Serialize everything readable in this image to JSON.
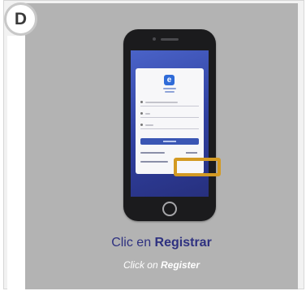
{
  "step_badge": "D",
  "caption_es": {
    "prefix": "Clic en ",
    "emphasis": "Registrar"
  },
  "caption_en": {
    "prefix": "Click on ",
    "emphasis": "Register"
  },
  "icons": {
    "app_logo": "e-app-logo",
    "phone_home": "home-button-icon"
  },
  "colors": {
    "panel": "#b3b3b3",
    "highlight": "#d39a23",
    "caption_es": "#2e3180",
    "caption_en": "#ffffff",
    "screen": "#3a56b4"
  }
}
